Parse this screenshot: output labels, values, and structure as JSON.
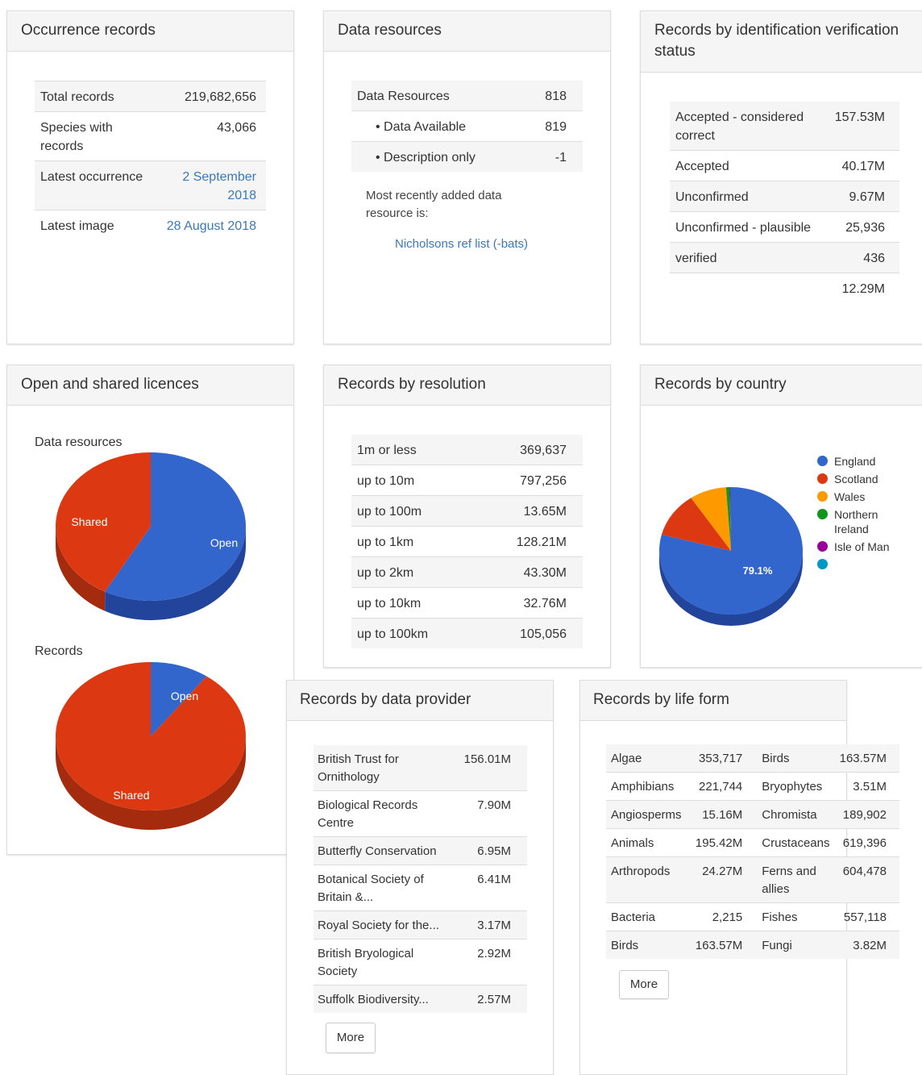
{
  "occurrence": {
    "title": "Occurrence records",
    "rows": [
      {
        "label": "Total records",
        "value": "219,682,656"
      },
      {
        "label": "Species with records",
        "value": "43,066"
      },
      {
        "label": "Latest occurrence",
        "value": "2 September 2018"
      },
      {
        "label": "Latest image",
        "value": "28 August 2018"
      }
    ]
  },
  "resources": {
    "title": "Data resources",
    "rows": [
      {
        "label": "Data Resources",
        "value": "818"
      },
      {
        "label": "• Data Available",
        "value": "819"
      },
      {
        "label": "• Description only",
        "value": "-1"
      }
    ],
    "recent_text": "Most recently added data resource is:",
    "recent_link": "Nicholsons ref list (-bats)"
  },
  "verification": {
    "title": "Records by identification verification status",
    "rows": [
      {
        "label": "Accepted - considered correct",
        "value": "157.53M"
      },
      {
        "label": "Accepted",
        "value": "40.17M"
      },
      {
        "label": "Unconfirmed",
        "value": "9.67M"
      },
      {
        "label": "Unconfirmed - plausible",
        "value": "25,936"
      },
      {
        "label": "verified",
        "value": "436"
      },
      {
        "label": "",
        "value": "12.29M"
      }
    ]
  },
  "licences": {
    "title": "Open and shared licences",
    "resources_caption": "Data resources",
    "records_caption": "Records",
    "colors": {
      "open": "#3366cc",
      "open_side": "#22449a",
      "shared": "#dc3912",
      "shared_side": "#a52b0e"
    }
  },
  "resolution": {
    "title": "Records by resolution",
    "rows": [
      {
        "label": "1m or less",
        "value": "369,637"
      },
      {
        "label": "up to 10m",
        "value": "797,256"
      },
      {
        "label": "up to 100m",
        "value": "13.65M"
      },
      {
        "label": "up to 1km",
        "value": "128.21M"
      },
      {
        "label": "up to 2km",
        "value": "43.30M"
      },
      {
        "label": "up to 10km",
        "value": "32.76M"
      },
      {
        "label": "up to 100km",
        "value": "105,056"
      }
    ]
  },
  "country": {
    "title": "Records by country",
    "pct_label": "79.1%",
    "legend": [
      {
        "label": "England",
        "color": "#3366cc"
      },
      {
        "label": "Scotland",
        "color": "#dc3912"
      },
      {
        "label": "Wales",
        "color": "#ff9900"
      },
      {
        "label": "Northern Ireland",
        "color": "#109618"
      },
      {
        "label": "Isle of Man",
        "color": "#990099"
      },
      {
        "label": "",
        "color": "#0099c6"
      }
    ]
  },
  "provider": {
    "title": "Records by data provider",
    "rows": [
      {
        "label": "British Trust for Ornithology",
        "value": "156.01M"
      },
      {
        "label": "Biological Records Centre",
        "value": "7.90M"
      },
      {
        "label": "Butterfly Conservation",
        "value": "6.95M"
      },
      {
        "label": "Botanical Society of Britain &...",
        "value": "6.41M"
      },
      {
        "label": "Royal Society for the...",
        "value": "3.17M"
      },
      {
        "label": "British Bryological Society",
        "value": "2.92M"
      },
      {
        "label": "Suffolk Biodiversity...",
        "value": "2.57M"
      }
    ],
    "more_label": "More"
  },
  "lifeform": {
    "title": "Records by life form",
    "rows": [
      {
        "a": "Algae",
        "av": "353,717",
        "b": "Birds",
        "bv": "163.57M"
      },
      {
        "a": "Amphibians",
        "av": "221,744",
        "b": "Bryophytes",
        "bv": "3.51M"
      },
      {
        "a": "Angiosperms",
        "av": "15.16M",
        "b": "Chromista",
        "bv": "189,902"
      },
      {
        "a": "Animals",
        "av": "195.42M",
        "b": "Crustaceans",
        "bv": "619,396"
      },
      {
        "a": "Arthropods",
        "av": "24.27M",
        "b": "Ferns and allies",
        "bv": "604,478"
      },
      {
        "a": "Bacteria",
        "av": "2,215",
        "b": "Fishes",
        "bv": "557,118"
      },
      {
        "a": "Birds",
        "av": "163.57M",
        "b": "Fungi",
        "bv": "3.82M"
      }
    ],
    "more_label": "More"
  },
  "chart_data": [
    {
      "type": "pie",
      "caption": "Data resources",
      "labels": [
        "Open",
        "Shared"
      ],
      "values": [
        58,
        42
      ],
      "colors": [
        "#3366cc",
        "#dc3912"
      ]
    },
    {
      "type": "pie",
      "caption": "Records",
      "labels": [
        "Open",
        "Shared"
      ],
      "values": [
        10,
        90
      ],
      "colors": [
        "#3366cc",
        "#dc3912"
      ]
    },
    {
      "type": "pie",
      "labels": [
        "England",
        "Scotland",
        "Wales",
        "Northern Ireland",
        "Isle of Man",
        ""
      ],
      "values": [
        79.1,
        11.5,
        8.3,
        0.8,
        0.2,
        0.1
      ],
      "data_label": "79.1%",
      "colors": [
        "#3366cc",
        "#dc3912",
        "#ff9900",
        "#109618",
        "#990099",
        "#0099c6"
      ]
    }
  ]
}
